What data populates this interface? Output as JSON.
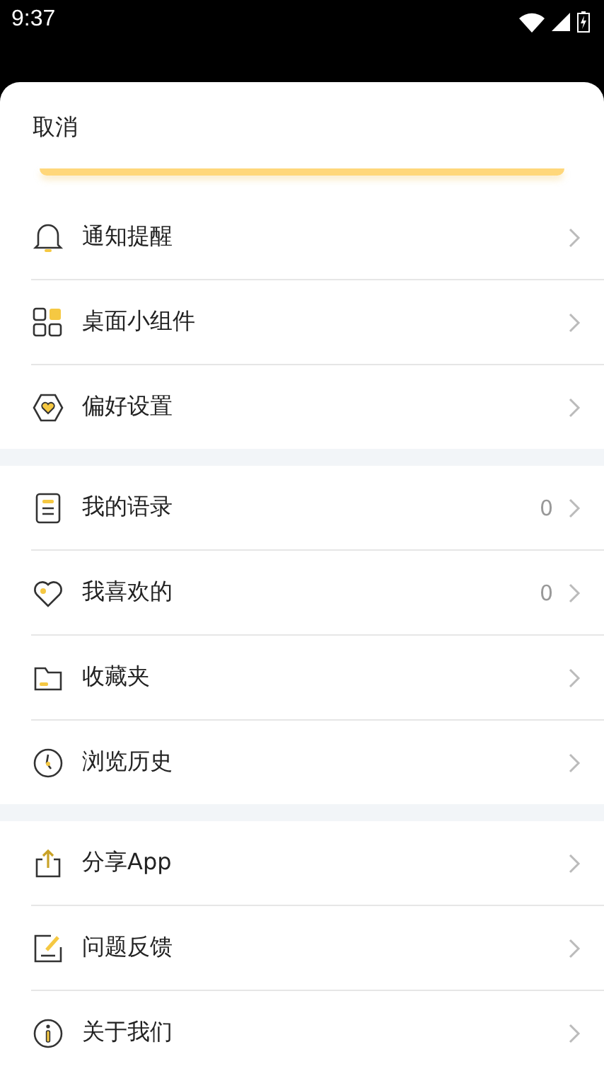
{
  "status_bar": {
    "time": "9:37"
  },
  "sheet": {
    "cancel": "取消",
    "groups": [
      {
        "items": [
          {
            "label": "通知提醒"
          },
          {
            "label": "桌面小组件"
          },
          {
            "label": "偏好设置"
          }
        ]
      },
      {
        "items": [
          {
            "label": "我的语录",
            "count": "0"
          },
          {
            "label": "我喜欢的",
            "count": "0"
          },
          {
            "label": "收藏夹"
          },
          {
            "label": "浏览历史"
          }
        ]
      },
      {
        "items": [
          {
            "label": "分享App"
          },
          {
            "label": "问题反馈"
          },
          {
            "label": "关于我们"
          }
        ]
      }
    ]
  }
}
